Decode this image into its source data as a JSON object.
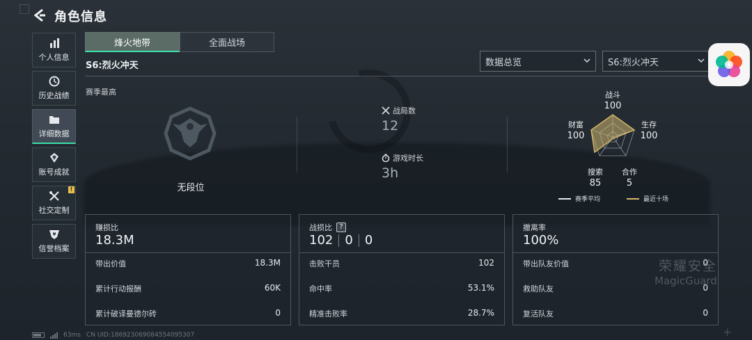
{
  "header": {
    "title": "角色信息"
  },
  "sidebar": {
    "items": [
      {
        "label": "个人信息",
        "icon": "bar-chart-icon",
        "active": false,
        "badge": ""
      },
      {
        "label": "历史战绩",
        "icon": "clock-icon",
        "active": false,
        "badge": ""
      },
      {
        "label": "详细数据",
        "icon": "folder-icon",
        "active": true,
        "badge": ""
      },
      {
        "label": "账号成就",
        "icon": "medal-icon",
        "active": false,
        "badge": ""
      },
      {
        "label": "社交定制",
        "icon": "tools-icon",
        "active": false,
        "badge": "!"
      },
      {
        "label": "信誉档案",
        "icon": "shield-heart-icon",
        "active": false,
        "badge": ""
      }
    ]
  },
  "tabs": [
    {
      "label": "烽火地带",
      "active": true
    },
    {
      "label": "全面战场",
      "active": false
    }
  ],
  "season_title": "S6:烈火冲天",
  "filters": {
    "view": "数据总览",
    "season": "S6:烈火冲天"
  },
  "overview": {
    "section_label": "赛季最高",
    "rank": "无段位",
    "matches_label": "战局数",
    "matches_value": "12",
    "playtime_label": "游戏时长",
    "playtime_value": "3h"
  },
  "radar": {
    "axes": [
      {
        "label": "战斗",
        "value": "100"
      },
      {
        "label": "生存",
        "value": "100"
      },
      {
        "label": "合作",
        "value": "5"
      },
      {
        "label": "搜索",
        "value": "85"
      },
      {
        "label": "财富",
        "value": "100"
      }
    ],
    "legend": [
      {
        "label": "赛季平均",
        "color": "#e6e9ec"
      },
      {
        "label": "最近十场",
        "color": "#d9b96a"
      }
    ]
  },
  "cards": [
    {
      "title": "赚损比",
      "big": "18.3M",
      "rows": [
        {
          "k": "带出价值",
          "v": "18.3M"
        },
        {
          "k": "累计行动报酬",
          "v": "60K"
        },
        {
          "k": "累计破译曼德尔砖",
          "v": "0"
        }
      ]
    },
    {
      "title": "战损比",
      "help_icon": "?",
      "big_parts": [
        "102",
        "0",
        "0"
      ],
      "rows": [
        {
          "k": "击败干员",
          "v": "102"
        },
        {
          "k": "命中率",
          "v": "53.1%"
        },
        {
          "k": "精准击败率",
          "v": "28.7%"
        }
      ]
    },
    {
      "title": "撤离率",
      "big": "100%",
      "rows": [
        {
          "k": "带出队友价值",
          "v": "0"
        },
        {
          "k": "救助队友",
          "v": "0"
        },
        {
          "k": "复活队友",
          "v": "0"
        }
      ]
    }
  ],
  "watermark": {
    "line1": "荣耀安全",
    "line2": "MagicGuard"
  },
  "status_bar": {
    "ping": "63ms",
    "uid": "CN UID:1869230690845540953​07"
  }
}
